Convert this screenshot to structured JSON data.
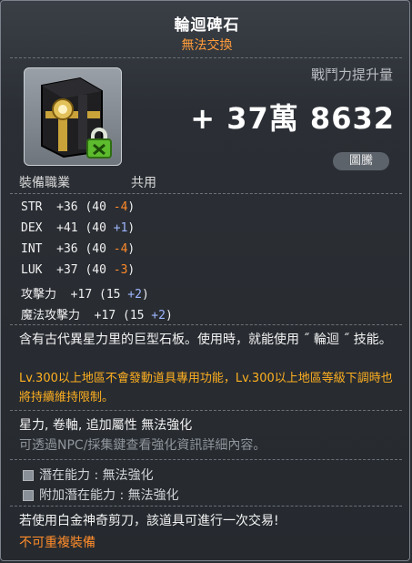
{
  "item": {
    "name": "輪迴碑石",
    "trade": "無法交換"
  },
  "power": {
    "label": "戰鬥力提升量",
    "value": "+ 37萬 8632"
  },
  "job": {
    "label": "裝備職業",
    "value": "共用",
    "tag": "圖騰"
  },
  "stats": [
    {
      "name": "STR",
      "total": "+36",
      "base": "40",
      "mod": "-4",
      "sign": "neg"
    },
    {
      "name": "DEX",
      "total": "+41",
      "base": "40",
      "mod": "+1",
      "sign": "pos"
    },
    {
      "name": "INT",
      "total": "+36",
      "base": "40",
      "mod": "-4",
      "sign": "neg"
    },
    {
      "name": "LUK",
      "total": "+37",
      "base": "40",
      "mod": "-3",
      "sign": "neg"
    },
    {
      "name": "攻擊力",
      "total": "+17",
      "base": "15",
      "mod": "+2",
      "sign": "pos"
    },
    {
      "name": "魔法攻擊力",
      "total": "+17",
      "base": "15",
      "mod": "+2",
      "sign": "pos"
    }
  ],
  "description": {
    "main": "含有古代異星力里的巨型石板。使用時，就能使用 ˝ 輪迴 ˝ 技能。",
    "notice": "Lv.300以上地區不會發動道具專用功能，Lv.300以上地區等級下調時也將持續維持限制。",
    "enhance": "星力, 卷軸, 追加屬性 無法強化",
    "hint": "可透過NPC/採集鍵查看強化資訊詳細內容。"
  },
  "potential": {
    "line1": "潛在能力 : 無法強化",
    "line2": "附加潛在能力 : 無法強化"
  },
  "footer": {
    "note": "若使用白金神奇剪刀，該道具可進行一次交易!",
    "warn": "不可重複裝備"
  },
  "colors": {
    "trade": "#ff9c3a",
    "negative": "#ff8a2a",
    "positive": "#9fb6ff",
    "notice": "#ffb020"
  },
  "icons": [
    "totem-stone-icon",
    "lock-icon",
    "checkbox-bullet-icon"
  ]
}
